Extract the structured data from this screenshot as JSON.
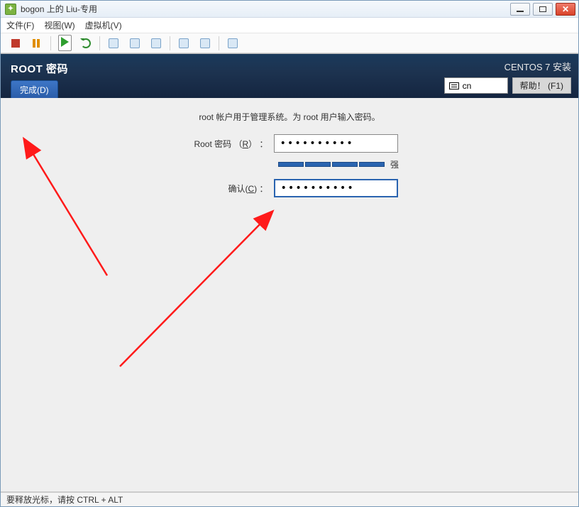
{
  "window": {
    "title": "bogon 上的 Liu-专用"
  },
  "menu": {
    "file": "文件(F)",
    "view": "视图(W)",
    "vm": "虚拟机(V)"
  },
  "anaconda": {
    "page_title": "ROOT 密码",
    "done_button": "完成(D)",
    "product": "CENTOS 7 安装",
    "keyboard": "cn",
    "help": "帮助！ (F1)",
    "instruction": "root 帐户用于管理系统。为 root 用户输入密码。",
    "root_label_pre": "Root 密码 （",
    "root_label_key": "R",
    "root_label_post": "） ：",
    "root_value": "••••••••••",
    "strength_label": "强",
    "confirm_label_pre": "确认(",
    "confirm_label_key": "C",
    "confirm_label_post": ") ：",
    "confirm_value": "••••••••••"
  },
  "statusbar": {
    "text": "要释放光标，请按 CTRL + ALT"
  },
  "icons": {
    "app": "vsphere-icon",
    "stop": "stop-icon",
    "pause": "pause-icon",
    "play": "play-icon",
    "refresh": "refresh-icon",
    "snapshot": "snapshot-icon",
    "snapshot_mgr": "snapshot-manager-icon",
    "fullscreen": "fullscreen-icon",
    "cdrom": "cdrom-icon",
    "floppy": "floppy-icon",
    "nic": "network-icon"
  }
}
